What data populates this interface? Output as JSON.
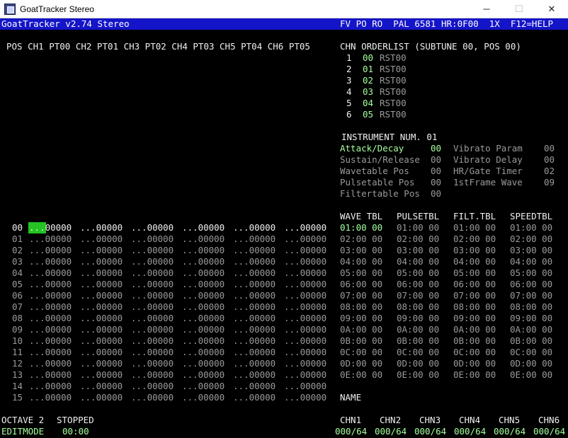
{
  "window": {
    "title": "GoatTracker Stereo",
    "min_glyph": "─",
    "max_glyph": "☐",
    "close_glyph": "✕"
  },
  "status": {
    "left": "GoatTracker v2.74 Stereo",
    "right": "FV PO RO  PAL 6581 HR:0F00  1X  F12=HELP"
  },
  "pattern": {
    "header": "POS CH1 PT00 CH2 PT01 CH3 PT02 CH4 PT03 CH5 PT04 CH6 PT05",
    "rows": [
      {
        "pos": "00",
        "cells": [
          "...00000",
          "...00000",
          "...00000",
          "...00000",
          "...00000",
          "...00000"
        ]
      },
      {
        "pos": "01",
        "cells": [
          "...00000",
          "...00000",
          "...00000",
          "...00000",
          "...00000",
          "...00000"
        ]
      },
      {
        "pos": "02",
        "cells": [
          "...00000",
          "...00000",
          "...00000",
          "...00000",
          "...00000",
          "...00000"
        ]
      },
      {
        "pos": "03",
        "cells": [
          "...00000",
          "...00000",
          "...00000",
          "...00000",
          "...00000",
          "...00000"
        ]
      },
      {
        "pos": "04",
        "cells": [
          "...00000",
          "...00000",
          "...00000",
          "...00000",
          "...00000",
          "...00000"
        ]
      },
      {
        "pos": "05",
        "cells": [
          "...00000",
          "...00000",
          "...00000",
          "...00000",
          "...00000",
          "...00000"
        ]
      },
      {
        "pos": "06",
        "cells": [
          "...00000",
          "...00000",
          "...00000",
          "...00000",
          "...00000",
          "...00000"
        ]
      },
      {
        "pos": "07",
        "cells": [
          "...00000",
          "...00000",
          "...00000",
          "...00000",
          "...00000",
          "...00000"
        ]
      },
      {
        "pos": "08",
        "cells": [
          "...00000",
          "...00000",
          "...00000",
          "...00000",
          "...00000",
          "...00000"
        ]
      },
      {
        "pos": "09",
        "cells": [
          "...00000",
          "...00000",
          "...00000",
          "...00000",
          "...00000",
          "...00000"
        ]
      },
      {
        "pos": "10",
        "cells": [
          "...00000",
          "...00000",
          "...00000",
          "...00000",
          "...00000",
          "...00000"
        ]
      },
      {
        "pos": "11",
        "cells": [
          "...00000",
          "...00000",
          "...00000",
          "...00000",
          "...00000",
          "...00000"
        ]
      },
      {
        "pos": "12",
        "cells": [
          "...00000",
          "...00000",
          "...00000",
          "...00000",
          "...00000",
          "...00000"
        ]
      },
      {
        "pos": "13",
        "cells": [
          "...00000",
          "...00000",
          "...00000",
          "...00000",
          "...00000",
          "...00000"
        ]
      },
      {
        "pos": "14",
        "cells": [
          "...00000",
          "...00000",
          "...00000",
          "...00000",
          "...00000",
          "...00000"
        ]
      },
      {
        "pos": "15",
        "cells": [
          "...00000",
          "...00000",
          "...00000",
          "...00000",
          "...00000",
          "...00000"
        ]
      }
    ]
  },
  "orderlist": {
    "header": "CHN ORDERLIST (SUBTUNE 00, POS 00)",
    "rows": [
      {
        "chn": "1",
        "pos": "00",
        "cmd": "RST00"
      },
      {
        "chn": "2",
        "pos": "01",
        "cmd": "RST00"
      },
      {
        "chn": "3",
        "pos": "02",
        "cmd": "RST00"
      },
      {
        "chn": "4",
        "pos": "03",
        "cmd": "RST00"
      },
      {
        "chn": "5",
        "pos": "04",
        "cmd": "RST00"
      },
      {
        "chn": "6",
        "pos": "05",
        "cmd": "RST00"
      }
    ]
  },
  "instrument": {
    "header": "INSTRUMENT NUM. 01",
    "left": [
      {
        "label": "Attack/Decay",
        "value": "00"
      },
      {
        "label": "Sustain/Release",
        "value": "00"
      },
      {
        "label": "Wavetable Pos",
        "value": "00"
      },
      {
        "label": "Pulsetable Pos",
        "value": "00"
      },
      {
        "label": "Filtertable Pos",
        "value": "00"
      }
    ],
    "right": [
      {
        "label": "Vibrato Param",
        "value": "00"
      },
      {
        "label": "Vibrato Delay",
        "value": "00"
      },
      {
        "label": "HR/Gate Timer",
        "value": "02"
      },
      {
        "label": "1stFrame Wave",
        "value": "09"
      }
    ]
  },
  "tables": {
    "headers": [
      "WAVE TBL",
      "PULSETBL",
      "FILT.TBL",
      "SPEEDTBL"
    ],
    "rows": [
      "01:00 00",
      "02:00 00",
      "03:00 00",
      "04:00 00",
      "05:00 00",
      "06:00 00",
      "07:00 00",
      "08:00 00",
      "09:00 00",
      "0A:00 00",
      "0B:00 00",
      "0C:00 00",
      "0D:00 00",
      "0E:00 00"
    ]
  },
  "name_label": "NAME",
  "footer": {
    "octave": "OCTAVE 2",
    "state": "STOPPED",
    "mode": "EDITMODE",
    "time": "00:00",
    "channels": [
      {
        "name": "CHN1",
        "value": "000/64"
      },
      {
        "name": "CHN2",
        "value": "000/64"
      },
      {
        "name": "CHN3",
        "value": "000/64"
      },
      {
        "name": "CHN4",
        "value": "000/64"
      },
      {
        "name": "CHN5",
        "value": "000/64"
      },
      {
        "name": "CHN6",
        "value": "000/64"
      }
    ]
  }
}
